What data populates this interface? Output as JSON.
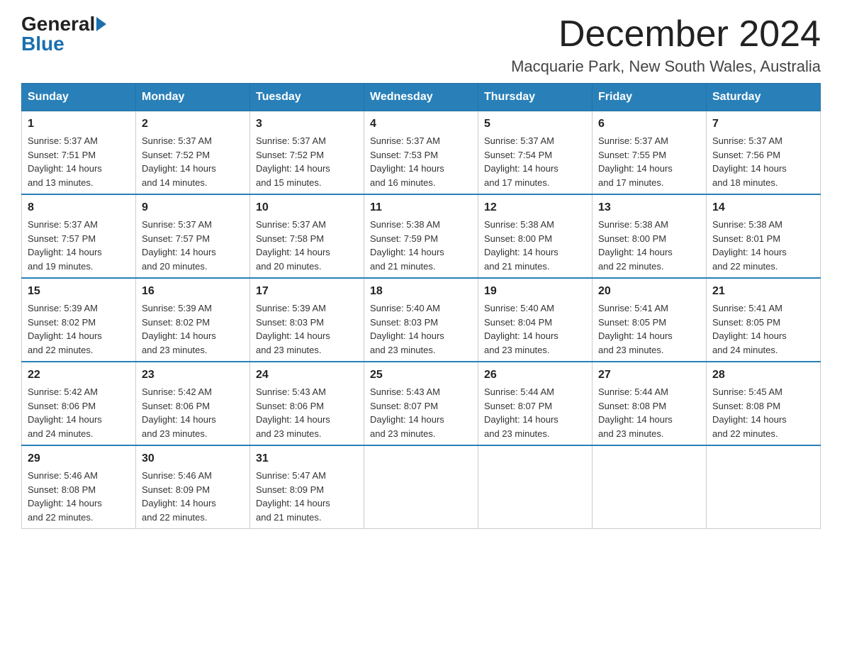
{
  "header": {
    "logo_general": "General",
    "logo_blue": "Blue",
    "month_title": "December 2024",
    "location": "Macquarie Park, New South Wales, Australia"
  },
  "weekdays": [
    "Sunday",
    "Monday",
    "Tuesday",
    "Wednesday",
    "Thursday",
    "Friday",
    "Saturday"
  ],
  "weeks": [
    [
      {
        "day": "1",
        "sunrise": "5:37 AM",
        "sunset": "7:51 PM",
        "daylight": "14 hours and 13 minutes."
      },
      {
        "day": "2",
        "sunrise": "5:37 AM",
        "sunset": "7:52 PM",
        "daylight": "14 hours and 14 minutes."
      },
      {
        "day": "3",
        "sunrise": "5:37 AM",
        "sunset": "7:52 PM",
        "daylight": "14 hours and 15 minutes."
      },
      {
        "day": "4",
        "sunrise": "5:37 AM",
        "sunset": "7:53 PM",
        "daylight": "14 hours and 16 minutes."
      },
      {
        "day": "5",
        "sunrise": "5:37 AM",
        "sunset": "7:54 PM",
        "daylight": "14 hours and 17 minutes."
      },
      {
        "day": "6",
        "sunrise": "5:37 AM",
        "sunset": "7:55 PM",
        "daylight": "14 hours and 17 minutes."
      },
      {
        "day": "7",
        "sunrise": "5:37 AM",
        "sunset": "7:56 PM",
        "daylight": "14 hours and 18 minutes."
      }
    ],
    [
      {
        "day": "8",
        "sunrise": "5:37 AM",
        "sunset": "7:57 PM",
        "daylight": "14 hours and 19 minutes."
      },
      {
        "day": "9",
        "sunrise": "5:37 AM",
        "sunset": "7:57 PM",
        "daylight": "14 hours and 20 minutes."
      },
      {
        "day": "10",
        "sunrise": "5:37 AM",
        "sunset": "7:58 PM",
        "daylight": "14 hours and 20 minutes."
      },
      {
        "day": "11",
        "sunrise": "5:38 AM",
        "sunset": "7:59 PM",
        "daylight": "14 hours and 21 minutes."
      },
      {
        "day": "12",
        "sunrise": "5:38 AM",
        "sunset": "8:00 PM",
        "daylight": "14 hours and 21 minutes."
      },
      {
        "day": "13",
        "sunrise": "5:38 AM",
        "sunset": "8:00 PM",
        "daylight": "14 hours and 22 minutes."
      },
      {
        "day": "14",
        "sunrise": "5:38 AM",
        "sunset": "8:01 PM",
        "daylight": "14 hours and 22 minutes."
      }
    ],
    [
      {
        "day": "15",
        "sunrise": "5:39 AM",
        "sunset": "8:02 PM",
        "daylight": "14 hours and 22 minutes."
      },
      {
        "day": "16",
        "sunrise": "5:39 AM",
        "sunset": "8:02 PM",
        "daylight": "14 hours and 23 minutes."
      },
      {
        "day": "17",
        "sunrise": "5:39 AM",
        "sunset": "8:03 PM",
        "daylight": "14 hours and 23 minutes."
      },
      {
        "day": "18",
        "sunrise": "5:40 AM",
        "sunset": "8:03 PM",
        "daylight": "14 hours and 23 minutes."
      },
      {
        "day": "19",
        "sunrise": "5:40 AM",
        "sunset": "8:04 PM",
        "daylight": "14 hours and 23 minutes."
      },
      {
        "day": "20",
        "sunrise": "5:41 AM",
        "sunset": "8:05 PM",
        "daylight": "14 hours and 23 minutes."
      },
      {
        "day": "21",
        "sunrise": "5:41 AM",
        "sunset": "8:05 PM",
        "daylight": "14 hours and 24 minutes."
      }
    ],
    [
      {
        "day": "22",
        "sunrise": "5:42 AM",
        "sunset": "8:06 PM",
        "daylight": "14 hours and 24 minutes."
      },
      {
        "day": "23",
        "sunrise": "5:42 AM",
        "sunset": "8:06 PM",
        "daylight": "14 hours and 23 minutes."
      },
      {
        "day": "24",
        "sunrise": "5:43 AM",
        "sunset": "8:06 PM",
        "daylight": "14 hours and 23 minutes."
      },
      {
        "day": "25",
        "sunrise": "5:43 AM",
        "sunset": "8:07 PM",
        "daylight": "14 hours and 23 minutes."
      },
      {
        "day": "26",
        "sunrise": "5:44 AM",
        "sunset": "8:07 PM",
        "daylight": "14 hours and 23 minutes."
      },
      {
        "day": "27",
        "sunrise": "5:44 AM",
        "sunset": "8:08 PM",
        "daylight": "14 hours and 23 minutes."
      },
      {
        "day": "28",
        "sunrise": "5:45 AM",
        "sunset": "8:08 PM",
        "daylight": "14 hours and 22 minutes."
      }
    ],
    [
      {
        "day": "29",
        "sunrise": "5:46 AM",
        "sunset": "8:08 PM",
        "daylight": "14 hours and 22 minutes."
      },
      {
        "day": "30",
        "sunrise": "5:46 AM",
        "sunset": "8:09 PM",
        "daylight": "14 hours and 22 minutes."
      },
      {
        "day": "31",
        "sunrise": "5:47 AM",
        "sunset": "8:09 PM",
        "daylight": "14 hours and 21 minutes."
      },
      null,
      null,
      null,
      null
    ]
  ],
  "labels": {
    "sunrise": "Sunrise:",
    "sunset": "Sunset:",
    "daylight": "Daylight:"
  }
}
